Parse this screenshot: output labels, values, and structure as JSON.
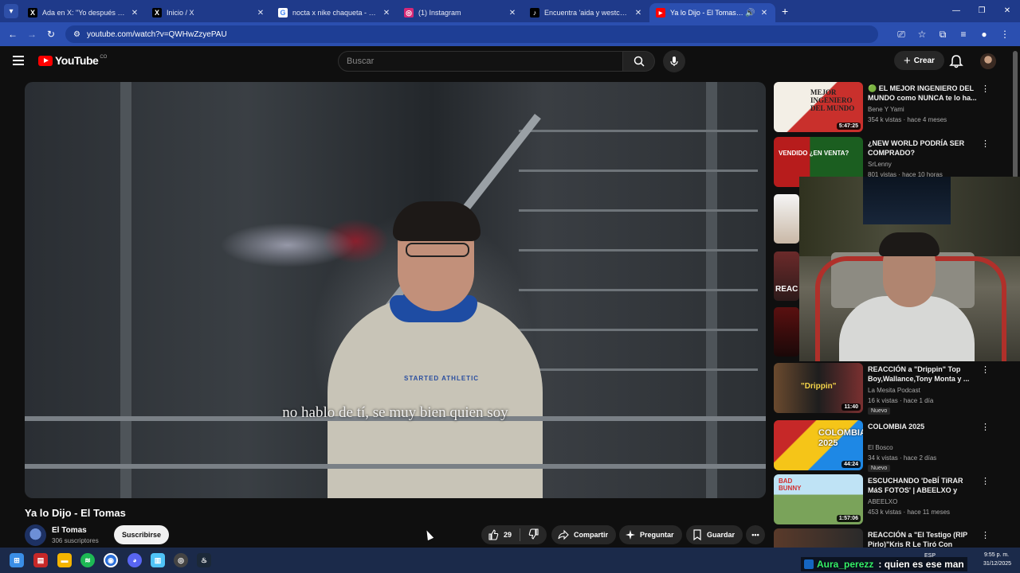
{
  "browser": {
    "tabs": [
      {
        "label": "Ada en X: \"Yo después de que",
        "icon": "x-logo-icon",
        "fav": "X",
        "fav_bg": "#000000"
      },
      {
        "label": "Inicio / X",
        "icon": "x-logo-icon",
        "fav": "X",
        "fav_bg": "#000000"
      },
      {
        "label": "nocta x nike chaqueta - Buscar",
        "icon": "google-icon",
        "fav": "G",
        "fav_bg": "#ffffff"
      },
      {
        "label": "(1) Instagram",
        "icon": "instagram-icon",
        "fav": "◎",
        "fav_bg": "#d62976"
      },
      {
        "label": "Encuentra 'aida y westcol' en Ti",
        "icon": "tiktok-icon",
        "fav": "♪",
        "fav_bg": "#000000"
      },
      {
        "label": "Ya lo Dijo - El Tomas - YouT",
        "icon": "youtube-icon",
        "fav": "▶",
        "fav_bg": "#ff0000",
        "active": true
      }
    ],
    "url": "youtube.com/watch?v=QWHwZzyePAU"
  },
  "youtube": {
    "logo_text": "YouTube",
    "country_code": "CO",
    "search_placeholder": "Buscar",
    "create_label": "Crear"
  },
  "video": {
    "subtitle": "no hablo de tí, se muy bien quien soy",
    "shirt_text": "STARTED ATHLETIC",
    "title": "Ya lo Dijo - El Tomas",
    "channel": "El Tomas",
    "subscribers": "306 suscriptores",
    "subscribe_label": "Suscribirse",
    "likes": "29",
    "share_label": "Compartir",
    "ask_label": "Preguntar",
    "save_label": "Guardar"
  },
  "recommendations": [
    {
      "title": "🟢 EL MEJOR INGENIERO DEL MUNDO como NUNCA te lo ha...",
      "channel": "Bene Y Yami",
      "meta": "354 k vistas · hace 4 meses",
      "duration": "5:47:25",
      "thumb_text": "MEJOR INGENIERO DEL MUNDO"
    },
    {
      "title": "¿NEW WORLD PODRÍA SER COMPRADO?",
      "channel": "SrLenny",
      "meta": "801 vistas · hace 10 horas",
      "duration": "",
      "thumb_text": "VENDIDO ¿EN VENTA?"
    },
    {
      "title": "REACCIÓN a \"Drippin\" Top Boy,Wallance,Tony Monta y ...",
      "channel": "La Mesita Podcast",
      "meta": "16 k vistas · hace 1 día",
      "duration": "11:40",
      "badge": "Nuevo",
      "thumb_text": "\"Drippin\""
    },
    {
      "title": "COLOMBIA 2025",
      "channel": "El Bosco",
      "meta": "34 k vistas · hace 2 días",
      "duration": "44:24",
      "badge": "Nuevo",
      "thumb_text": "COLOMBIA 2025"
    },
    {
      "title": "ESCUCHANDO 'DeBÍ TiRAR MáS FOTOS' | ABEELXO y compañia.",
      "channel": "ABEELXO",
      "meta": "453 k vistas · hace 11 meses",
      "duration": "1:57:06",
      "thumb_text": "BAD BUNNY"
    },
    {
      "title": "REACCIÓN a \"El Testigo (RIP Pirlo)\"Kris R Le Tiró Con TODO...",
      "channel": "",
      "meta": "",
      "duration": "",
      "thumb_text": ""
    }
  ],
  "partial_thumb_text": "REAC",
  "chat": {
    "user": "Aura_perezz",
    "message": ": quien es ese man"
  },
  "taskbar": {
    "lang": "ESP",
    "time": "9:55 p. m.",
    "date": "31/12/2025"
  },
  "colors": {
    "accent": "#ff0000",
    "browser_bar": "#2b4fb0",
    "chat_user": "#35f06a"
  }
}
